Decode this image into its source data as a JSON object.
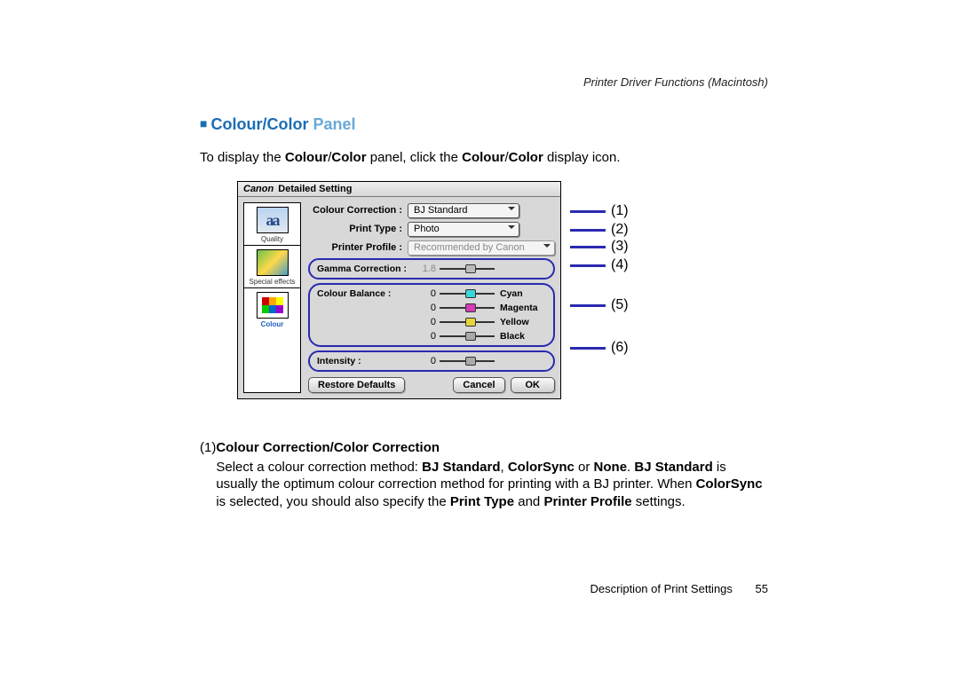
{
  "header": "Printer Driver Functions (Macintosh)",
  "sectionTitle": {
    "main": "Colour/Color",
    "light": " Panel"
  },
  "intro": {
    "pre": "To display the ",
    "b1": "Colour",
    "sep1": "/",
    "b2": "Color",
    "mid": " panel, click the ",
    "b3": "Colour",
    "sep2": "/",
    "b4": "Color",
    "post": " display icon."
  },
  "dialog": {
    "titleBrand": "Canon",
    "titleText": " Detailed Setting",
    "sidebar": {
      "quality": "Quality",
      "fx": "Special effects",
      "colour": "Colour"
    },
    "rows": {
      "colourCorrLbl": "Colour Correction :",
      "colourCorrVal": "BJ Standard",
      "printTypeLbl": "Print Type :",
      "printTypeVal": "Photo",
      "profileLbl": "Printer Profile :",
      "profileVal": "Recommended by Canon",
      "gammaLbl": "Gamma Correction :",
      "gammaVal": "1.8",
      "balanceLbl": "Colour Balance :",
      "intensityLbl": "Intensity :",
      "zero": "0",
      "cyan": "Cyan",
      "magenta": "Magenta",
      "yellow": "Yellow",
      "black": "Black",
      "restore": "Restore Defaults",
      "cancel": "Cancel",
      "ok": "OK"
    }
  },
  "callouts": {
    "n1": "(1)",
    "n2": "(2)",
    "n3": "(3)",
    "n4": "(4)",
    "n5": "(5)",
    "n6": "(6)"
  },
  "desc": {
    "num": "(1)",
    "title": "Colour Correction/Color Correction",
    "t1": "Select a colour correction method: ",
    "b1": "BJ Standard",
    "c1": ", ",
    "b2": "ColorSync",
    "c2": " or ",
    "b3": "None",
    "c3": ". ",
    "b4": "BJ Standard",
    "t2": " is usually the optimum colour correction method for printing with a BJ printer. When ",
    "b5": "ColorSync",
    "t3": " is selected, you should also specify the ",
    "b6": "Print Type",
    "c4": " and ",
    "b7": "Printer Profile",
    "t4": " settings."
  },
  "footer": {
    "text": "Description of Print Settings",
    "page": "55"
  }
}
